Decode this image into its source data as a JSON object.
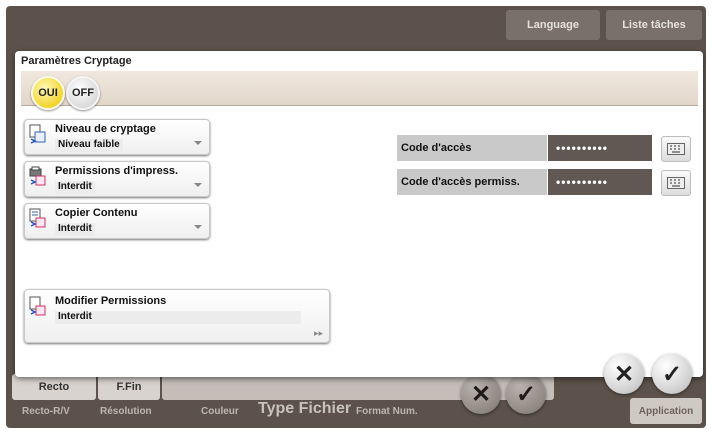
{
  "top_bar": {
    "language_label": "Language",
    "job_list_label": "Liste tâches"
  },
  "dialog": {
    "title": "Paramètres Cryptage",
    "toggle_on_label": "OUI",
    "toggle_off_label": "OFF",
    "settings": [
      {
        "label": "Niveau de cryptage",
        "value": "Niveau faible",
        "icon": "encryption-icon"
      },
      {
        "label": "Permissions d'impress.",
        "value": "Interdit",
        "icon": "printer-permission-icon"
      },
      {
        "label": "Copier Contenu",
        "value": "Interdit",
        "icon": "copy-content-icon"
      }
    ],
    "modify": {
      "label": "Modifier Permissions",
      "value": "Interdit",
      "icon": "modify-permissions-icon"
    },
    "fields": [
      {
        "label": "Code d'accès",
        "value": "••••••••••"
      },
      {
        "label": "Code d'accès permiss.",
        "value": "••••••••••"
      }
    ],
    "accent_color": "#f2d224"
  },
  "bottom_bar": {
    "recto_label": "Recto",
    "fin_label": "F.Fin",
    "labels": [
      "Recto-R/V",
      "Résolution",
      "Couleur",
      "Type Fichier",
      "Format Num."
    ],
    "application_label": "Application"
  }
}
